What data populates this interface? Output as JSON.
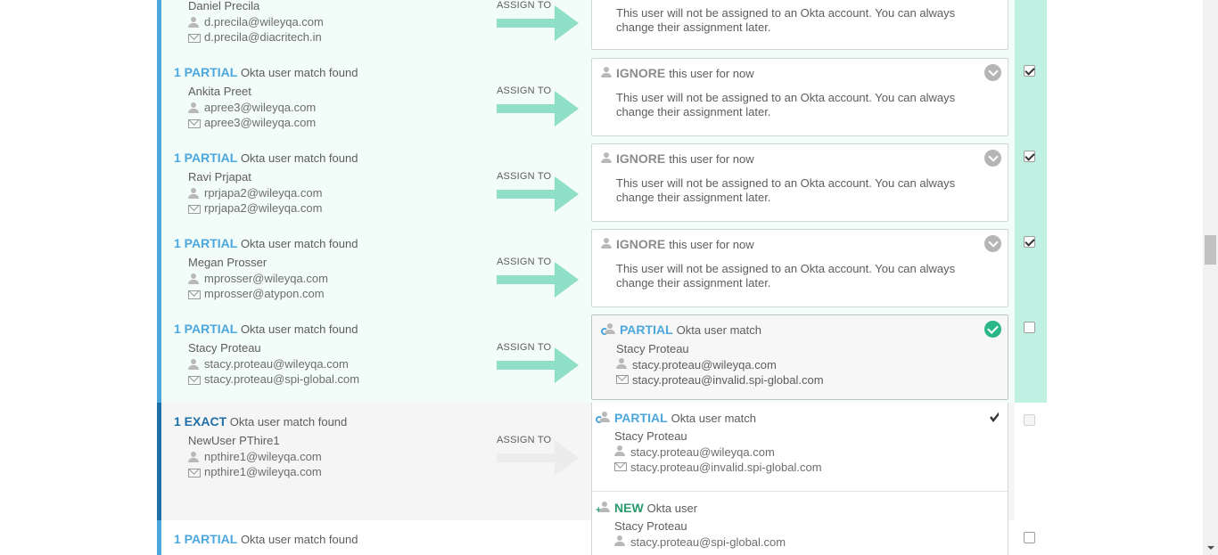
{
  "rows": [
    {
      "match_kw": "",
      "match_text": "",
      "user_name": "Daniel Precila",
      "login": "d.precila@wileyqa.com",
      "email": "d.precila@diacritech.in",
      "assign_label": "ASSIGN TO",
      "card_kw": "",
      "card_text": "",
      "card_body": "This user will not be assigned to an Okta account. You can always change their assignment later.",
      "checked": false
    },
    {
      "match_kw": "1 PARTIAL",
      "match_text": "Okta user match found",
      "user_name": "Ankita Preet",
      "login": "apree3@wileyqa.com",
      "email": "apree3@wileyqa.com",
      "assign_label": "ASSIGN TO",
      "card_kw": "IGNORE",
      "card_text": "this user for now",
      "card_body": "This user will not be assigned to an Okta account. You can always change their assignment later.",
      "checked": true
    },
    {
      "match_kw": "1 PARTIAL",
      "match_text": "Okta user match found",
      "user_name": "Ravi Prjapat",
      "login": "rprjapa2@wileyqa.com",
      "email": "rprjapa2@wileyqa.com",
      "assign_label": "ASSIGN TO",
      "card_kw": "IGNORE",
      "card_text": "this user for now",
      "card_body": "This user will not be assigned to an Okta account. You can always change their assignment later.",
      "checked": true
    },
    {
      "match_kw": "1 PARTIAL",
      "match_text": "Okta user match found",
      "user_name": "Megan Prosser",
      "login": "mprosser@wileyqa.com",
      "email": "mprosser@atypon.com",
      "assign_label": "ASSIGN TO",
      "card_kw": "IGNORE",
      "card_text": "this user for now",
      "card_body": "This user will not be assigned to an Okta account. You can always change their assignment later.",
      "checked": true
    },
    {
      "match_kw": "1 PARTIAL",
      "match_text": "Okta user match found",
      "user_name": "Stacy Proteau",
      "login": "stacy.proteau@wileyqa.com",
      "email": "stacy.proteau@spi-global.com",
      "assign_label": "ASSIGN TO",
      "card_kw": "PARTIAL",
      "card_text": "Okta user match",
      "card_name": "Stacy Proteau",
      "card_login": "stacy.proteau@wileyqa.com",
      "card_email": "stacy.proteau@invalid.spi-global.com",
      "checked": false
    },
    {
      "match_kw": "1 EXACT",
      "match_text": "Okta user match found",
      "user_name": "NewUser PThire1",
      "login": "npthire1@wileyqa.com",
      "email": "npthire1@wileyqa.com",
      "assign_label": "ASSIGN TO",
      "checked": false
    },
    {
      "match_kw": "1 PARTIAL",
      "match_text": "Okta user match found",
      "checked": false
    }
  ],
  "dropdown": {
    "items": [
      {
        "kw": "PARTIAL",
        "text": "Okta user match",
        "name": "Stacy Proteau",
        "login": "stacy.proteau@wileyqa.com",
        "email": "stacy.proteau@invalid.spi-global.com",
        "selected": true
      },
      {
        "kw": "NEW",
        "text": "Okta user",
        "name": "Stacy Proteau",
        "login": "stacy.proteau@spi-global.com"
      }
    ]
  },
  "colors": {
    "partial": "#4ba7dd",
    "exact": "#1f6fa8",
    "new": "#2b9b6e",
    "arrow": "#8fe0c6",
    "check_col": "#c0f0e1"
  }
}
